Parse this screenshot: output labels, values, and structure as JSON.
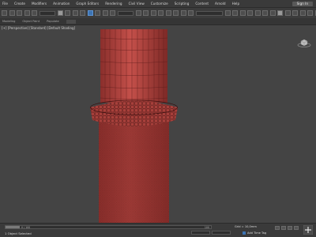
{
  "menu": {
    "items": [
      "File",
      "Create",
      "Modifiers",
      "Animation",
      "Graph Editors",
      "Rendering",
      "Civil View",
      "Customize",
      "Scripting",
      "Content",
      "Arnold",
      "Help"
    ],
    "sign_in": "Sign In"
  },
  "ribbon": {
    "tabs": [
      "Modeling",
      "Object Paint",
      "Populate"
    ]
  },
  "viewport": {
    "label": "[+] [Perspective] [Standard] [Default Shading]",
    "object_color": "#b3403c",
    "wire_color": "#3a1010"
  },
  "status": {
    "selection": "1 Object Selected",
    "trackbar_start": "0 / 100",
    "trackbar_end": "100",
    "grid": "Grid = 10,0mm",
    "add_time_tag": "Add Time Tag"
  },
  "colors": {
    "accent": "#3d74b3",
    "viewport_bg": "#444444"
  }
}
